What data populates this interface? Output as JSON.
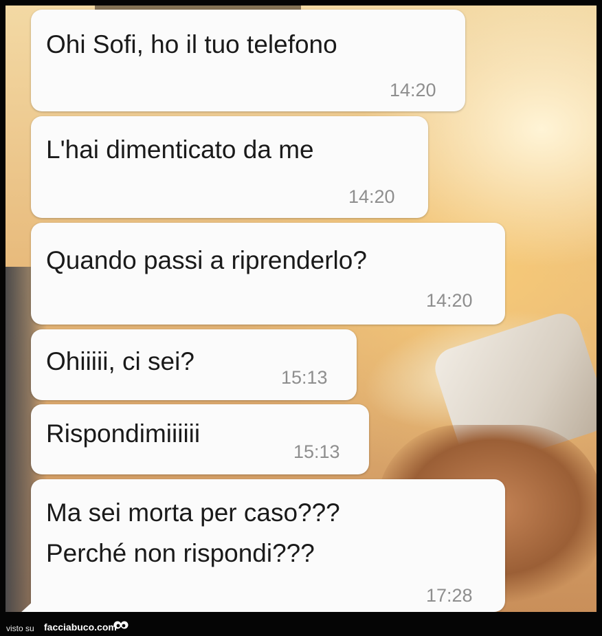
{
  "messages": [
    {
      "text": "Ohi Sofi, ho il tuo telefono",
      "time": "14:20"
    },
    {
      "text": "L'hai dimenticato da me",
      "time": "14:20"
    },
    {
      "text": "Quando passi a riprenderlo?",
      "time": "14:20"
    },
    {
      "text": "Ohiiiii, ci sei?",
      "time": "15:13"
    },
    {
      "text": "Rispondimiiiiii",
      "time": "15:13"
    },
    {
      "text_line1": "Ma sei morta per caso???",
      "text_line2": "Perché non rispondi???",
      "time": "17:28"
    }
  ],
  "footer": {
    "visto_label": "visto su",
    "site_label": "facciabuco.com",
    "logo_icon": "eyes-icon"
  },
  "colors": {
    "bubble_bg": "#fbfbfb",
    "timestamp": "#8e8e8e",
    "frame": "#050505"
  }
}
